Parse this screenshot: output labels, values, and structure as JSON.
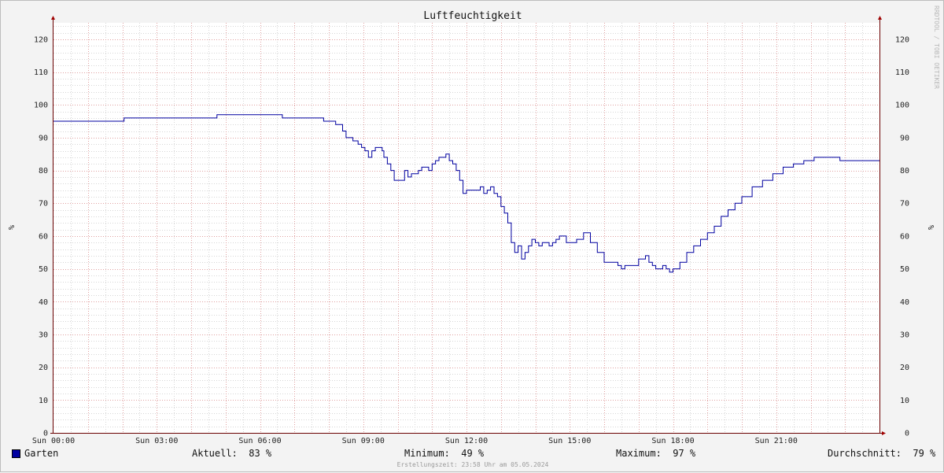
{
  "chart_data": {
    "type": "line",
    "title": "Luftfeuchtigkeit",
    "ylabel": "%",
    "ylim": [
      0,
      125
    ],
    "y_ticks": [
      0,
      10,
      20,
      30,
      40,
      50,
      60,
      70,
      80,
      90,
      100,
      110,
      120
    ],
    "xlim": [
      0,
      24
    ],
    "x_ticks": [
      {
        "value": 0,
        "label": "Sun 00:00"
      },
      {
        "value": 3,
        "label": "Sun 03:00"
      },
      {
        "value": 6,
        "label": "Sun 06:00"
      },
      {
        "value": 9,
        "label": "Sun 09:00"
      },
      {
        "value": 12,
        "label": "Sun 12:00"
      },
      {
        "value": 15,
        "label": "Sun 15:00"
      },
      {
        "value": 18,
        "label": "Sun 18:00"
      },
      {
        "value": 21,
        "label": "Sun 21:00"
      }
    ],
    "grid": true,
    "series": [
      {
        "name": "Garten",
        "color": "#0000a0",
        "x": [
          0,
          2.05,
          2.05,
          4.75,
          4.75,
          6.6,
          6.65,
          7.85,
          7.85,
          8.2,
          8.2,
          8.4,
          8.5,
          8.6,
          8.7,
          8.85,
          8.95,
          9.05,
          9.15,
          9.25,
          9.35,
          9.45,
          9.55,
          9.6,
          9.7,
          9.8,
          9.9,
          10.2,
          10.3,
          10.4,
          10.5,
          10.6,
          10.7,
          10.8,
          10.9,
          11.0,
          11.1,
          11.2,
          11.3,
          11.4,
          11.5,
          11.6,
          11.7,
          11.8,
          11.9,
          12.0,
          12.1,
          12.2,
          12.3,
          12.4,
          12.5,
          12.6,
          12.7,
          12.8,
          12.9,
          13.0,
          13.1,
          13.2,
          13.3,
          13.4,
          13.5,
          13.6,
          13.7,
          13.8,
          13.9,
          14.0,
          14.1,
          14.2,
          14.3,
          14.4,
          14.5,
          14.6,
          14.7,
          14.8,
          14.9,
          15.0,
          15.2,
          15.4,
          15.6,
          15.8,
          16.0,
          16.2,
          16.4,
          16.5,
          16.6,
          16.8,
          17.0,
          17.2,
          17.3,
          17.4,
          17.5,
          17.6,
          17.7,
          17.8,
          17.9,
          18.0,
          18.2,
          18.4,
          18.6,
          18.8,
          19.0,
          19.2,
          19.4,
          19.6,
          19.8,
          20.0,
          20.3,
          20.6,
          20.9,
          21.2,
          21.5,
          21.8,
          22.1,
          22.4,
          22.6,
          22.8,
          22.85,
          22.9,
          24
        ],
        "values": [
          95,
          95,
          96,
          96,
          97,
          97,
          96,
          96,
          95,
          95,
          94,
          92,
          90,
          90,
          89,
          88,
          87,
          86,
          84,
          86,
          87,
          87,
          86,
          84,
          82,
          80,
          77,
          80,
          78,
          79,
          79,
          80,
          81,
          81,
          80,
          82,
          83,
          84,
          84,
          85,
          83,
          82,
          80,
          77,
          73,
          74,
          74,
          74,
          74,
          75,
          73,
          74,
          75,
          73,
          72,
          69,
          67,
          64,
          58,
          55,
          57,
          53,
          55,
          57,
          59,
          58,
          57,
          58,
          58,
          57,
          58,
          59,
          60,
          60,
          58,
          58,
          59,
          61,
          58,
          55,
          52,
          52,
          51,
          50,
          51,
          51,
          53,
          54,
          52,
          51,
          50,
          50,
          51,
          50,
          49,
          50,
          52,
          55,
          57,
          59,
          61,
          63,
          66,
          68,
          70,
          72,
          75,
          77,
          79,
          81,
          82,
          83,
          84,
          84,
          84,
          84,
          83,
          83,
          83
        ]
      }
    ]
  },
  "legend": {
    "series_name": "Garten",
    "current_label": "Aktuell:",
    "current_value": "83 %",
    "min_label": "Minimum:",
    "min_value": "49 %",
    "max_label": "Maximum:",
    "max_value": "97 %",
    "avg_label": "Durchschnitt:",
    "avg_value": "79 %"
  },
  "footer": "Erstellungszeit: 23:58 Uhr am 05.05.2024",
  "watermark": "RRDTOOL / TOBI OETIKER",
  "colors": {
    "line": "#0000a0",
    "major_grid": "#e0a0a0",
    "minor_grid": "#d6d6d6",
    "axis": "#6a0000"
  }
}
